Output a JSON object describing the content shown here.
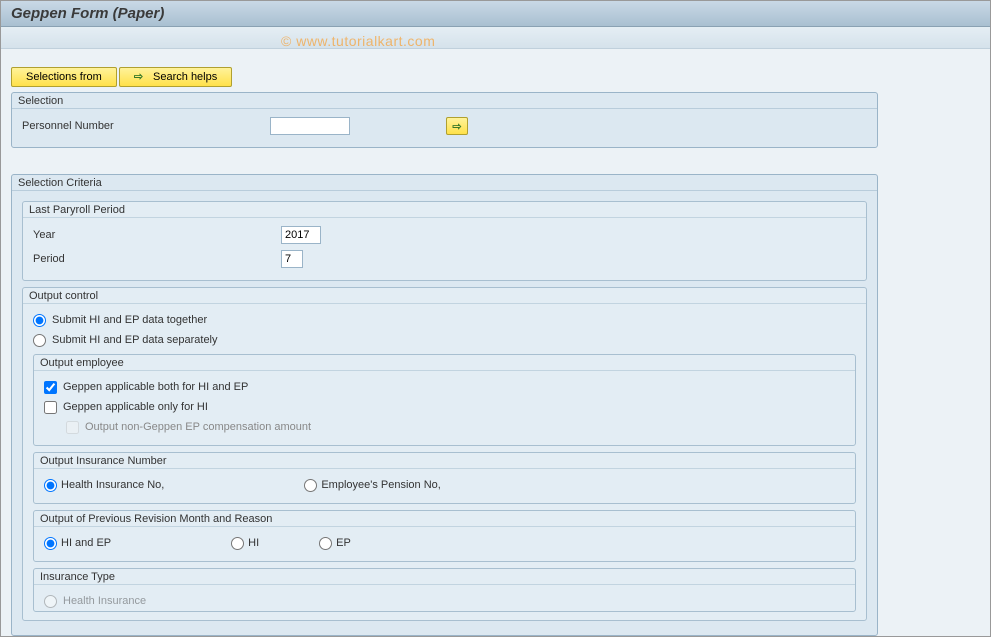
{
  "titlebar": {
    "title": "Geppen Form (Paper)"
  },
  "watermark": "© www.tutorialkart.com",
  "toolbar": {
    "selections_from": "Selections from",
    "search_helps": "Search helps"
  },
  "selection_group": {
    "title": "Selection",
    "personnel_label": "Personnel Number",
    "personnel_value": ""
  },
  "criteria_group": {
    "title": "Selection Criteria",
    "last_payroll": {
      "title": "Last Paryroll Period",
      "year_label": "Year",
      "year_value": "2017",
      "period_label": "Period",
      "period_value": "7"
    },
    "output_control": {
      "title": "Output control",
      "r1": "Submit HI and EP data together",
      "r2": "Submit HI and EP data separately",
      "output_employee": {
        "title": "Output employee",
        "c1": "Geppen applicable both for HI and EP",
        "c2": "Geppen applicable only for HI",
        "c3": "Output non-Geppen EP compensation amount"
      },
      "output_ins_no": {
        "title": "Output Insurance Number",
        "r1": "Health Insurance No,",
        "r2": "Employee's Pension No,"
      },
      "output_prev": {
        "title": "Output of Previous Revision Month and Reason",
        "r1": "HI and EP",
        "r2": "HI",
        "r3": "EP"
      },
      "ins_type": {
        "title": "Insurance Type",
        "r1": "Health Insurance"
      }
    }
  }
}
